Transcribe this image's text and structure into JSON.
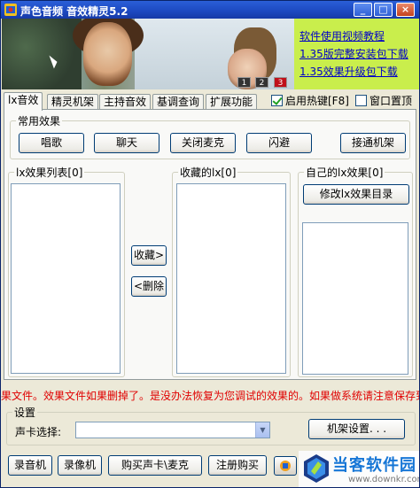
{
  "window": {
    "title": "声色音频 音效精灵5.2",
    "min_label": "_",
    "max_label": "□",
    "close_label": "×"
  },
  "banner": {
    "pages": [
      "1",
      "2",
      "3"
    ],
    "links": [
      "软件使用视频教程",
      "1.35版完整安装包下载",
      "1.35效果升级包下载"
    ]
  },
  "tabs": [
    "lx音效",
    "精灵机架",
    "主持音效",
    "基调查询",
    "扩展功能"
  ],
  "hotkey_label": "启用热键[F8]",
  "hotkey_checked": true,
  "topmost_label": "窗口置顶",
  "common": {
    "legend": "常用效果",
    "buttons": [
      "唱歌",
      "聊天",
      "关闭麦克",
      "闪避",
      "接通机架"
    ]
  },
  "lists": {
    "effects_legend": "lx效果列表[0]",
    "favorites_legend": "收藏的lx[0]",
    "own_legend": "自己的lx效果[0]",
    "collect_button": "收藏>",
    "delete_button": "<删除",
    "modify_button": "修改lx效果目录"
  },
  "marquee": "果文件。效果文件如果删掉了。是没办法恢复为您调试的效果的。如果做系统请注意保存到",
  "settings": {
    "legend": "设置",
    "soundcard_label": "声卡选择:",
    "soundcard_value": "",
    "rack_button": "机架设置. . ."
  },
  "bottom_buttons": [
    "录音机",
    "录像机",
    "购买声卡\\麦克",
    "注册购买"
  ],
  "watermark": {
    "title": "当客软件园",
    "url": "www.downkr.com"
  }
}
